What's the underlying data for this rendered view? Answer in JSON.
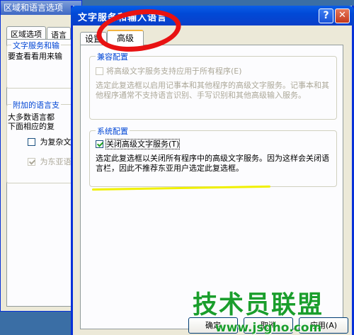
{
  "background_window": {
    "title": "区域和语言选项",
    "tabs": [
      "区域选项",
      "语言"
    ],
    "group1_title": "文字服务和输",
    "group1_text": "要查看看用来输",
    "group2_title": "附加的语言支",
    "group2_text_1": "大多数语言都",
    "group2_text_2": "下面相应的复",
    "checkbox1_label": "为复杂文",
    "checkbox2_label": "为东亚语"
  },
  "dialog": {
    "title": "文字服务和输入语言",
    "help_symbol": "?",
    "close_symbol": "✕",
    "tabs": [
      {
        "label": "设置",
        "active": false
      },
      {
        "label": "高级",
        "active": true
      }
    ],
    "compat_group": {
      "title": "兼容配置",
      "checkbox_label": "将高级文字服务支持应用于所有程序(E)",
      "checkbox_checked": false,
      "disabled": true,
      "description": "选定此复选框以启用记事本和其他程序的高级文字服务。记事本和其他程序通常不支持语言识别、手写识别和其他高级输入服务。"
    },
    "system_group": {
      "title": "系统配置",
      "checkbox_label": "关闭高级文字服务(T)",
      "checkbox_checked": true,
      "description": "选定此复选框以关闭所有程序中的高级文字服务。因为这样会关闭语言栏，因此不推荐东亚用户选定此复选框。"
    },
    "buttons": {
      "ok": "确定",
      "cancel": "取消",
      "apply": "应用(A)"
    }
  },
  "watermark": {
    "logo": "技术员联盟",
    "url": "www.jsgho.com"
  },
  "colors": {
    "titlebar": "#0a5ee8",
    "group_title": "#0046d5",
    "annotation_red": "#e81212",
    "annotation_yellow": "#f0f000",
    "watermark_green": "#1a9e2c"
  }
}
